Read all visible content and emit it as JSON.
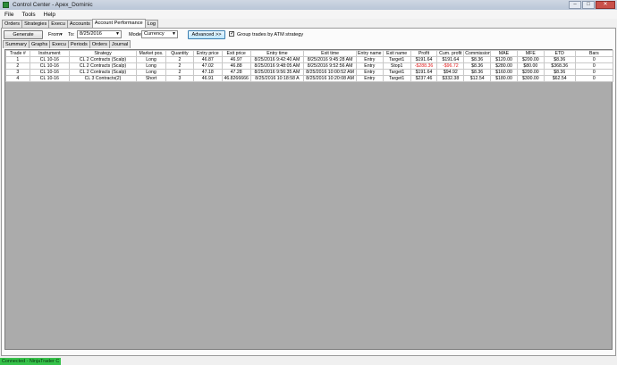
{
  "window": {
    "title": "Control Center - Apex_Dominic",
    "minimize": "–",
    "maximize": "□",
    "close": "✕"
  },
  "menu": [
    "File",
    "Tools",
    "Help"
  ],
  "top_tabs": [
    {
      "label": "Orders",
      "active": false
    },
    {
      "label": "Strategies",
      "active": false
    },
    {
      "label": "Execu",
      "active": false
    },
    {
      "label": "Accounts",
      "active": false
    },
    {
      "label": "Account Performance",
      "active": true
    },
    {
      "label": "Log",
      "active": false
    }
  ],
  "toolbar": {
    "generate_label": "Generate",
    "from_label": "From▾",
    "to_label": "To:",
    "to_date": "8/25/2016",
    "mode_label": "Mode:",
    "mode_value": "Currency",
    "advanced_label": "Advanced >>",
    "group_checked": "✓",
    "group_label": "Group trades by ATM strategy"
  },
  "sub_tabs": [
    {
      "label": "Summary",
      "active": false
    },
    {
      "label": "Graphs",
      "active": false
    },
    {
      "label": "Execu",
      "active": false
    },
    {
      "label": "Periods",
      "active": false
    },
    {
      "label": "Orders",
      "active": false
    },
    {
      "label": "Journal",
      "active": false
    }
  ],
  "table": {
    "headers": [
      "Trade #",
      "Instrument",
      "Strategy",
      "Market pos.",
      "Quantity",
      "Entry price",
      "Exit price",
      "Entry time",
      "Exit time",
      "Entry name",
      "Exit name",
      "Profit",
      "Cum. profit",
      "Commission",
      "MAE",
      "MFE",
      "ETD",
      "Bars"
    ],
    "rows": [
      [
        "1",
        "CL 10-16",
        "CL 2 Contracts (Scalp)",
        "Long",
        "2",
        "46.87",
        "46.97",
        "8/25/2016 9:42:40 AM",
        "8/25/2016 9:45:28 AM",
        "Entry",
        "Target1",
        "$191.64",
        "$191.64",
        "$8.36",
        "$120.00",
        "$200.00",
        "$8.36",
        "0"
      ],
      [
        "2",
        "CL 10-16",
        "CL 2 Contracts (Scalp)",
        "Long",
        "2",
        "47.02",
        "46.88",
        "8/25/2016 9:48:05 AM",
        "8/25/2016 9:52:56 AM",
        "Entry",
        "Stop1",
        "-$288.36",
        "-$96.72",
        "$8.36",
        "$280.00",
        "$80.00",
        "$368.36",
        "0"
      ],
      [
        "3",
        "CL 10-16",
        "CL 2 Contracts (Scalp)",
        "Long",
        "2",
        "47.18",
        "47.28",
        "8/25/2016 9:56:35 AM",
        "8/25/2016 10:00:52 AM",
        "Entry",
        "Target1",
        "$191.64",
        "$94.92",
        "$8.36",
        "$160.00",
        "$200.00",
        "$8.36",
        "0"
      ],
      [
        "4",
        "CL 10-16",
        "CL 3 Contracts(2)",
        "Short",
        "3",
        "46.91",
        "46.8266666",
        "8/25/2016 10:18:58 A",
        "8/25/2016 10:20:08 AM",
        "Entry",
        "Target1",
        "$237.46",
        "$332.38",
        "$12.54",
        "$180.00",
        "$300.00",
        "$62.54",
        "0"
      ]
    ],
    "negative_cells": [
      [
        1,
        11
      ],
      [
        1,
        12
      ]
    ],
    "negative_color": "#e21b1b"
  },
  "status": {
    "connection": "Connected - NinjaTrader C",
    "color": "#36c24a"
  }
}
